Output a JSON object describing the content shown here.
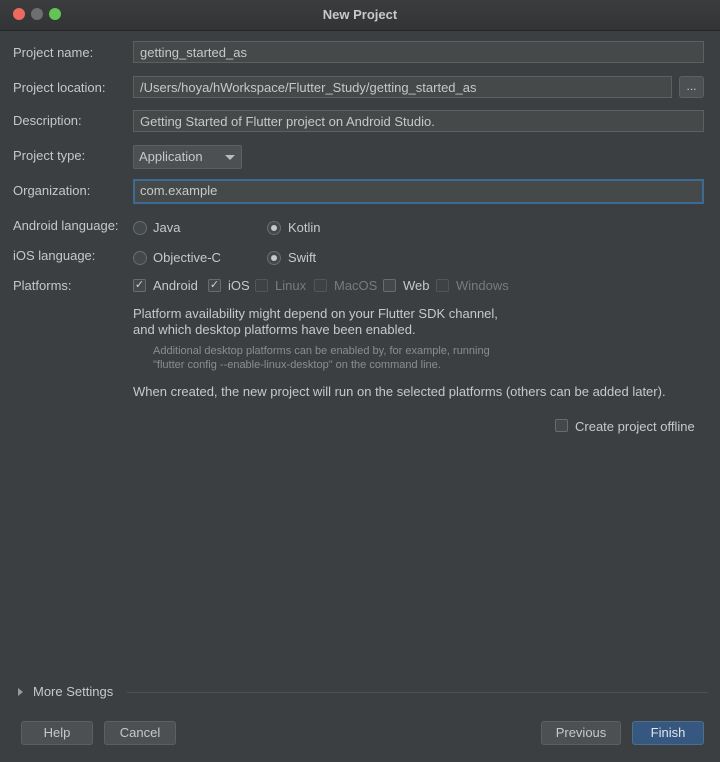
{
  "window": {
    "title": "New Project"
  },
  "labels": {
    "project_name": "Project name:",
    "project_location": "Project location:",
    "description": "Description:",
    "project_type": "Project type:",
    "organization": "Organization:",
    "android_language": "Android language:",
    "ios_language": "iOS language:",
    "platforms": "Platforms:"
  },
  "fields": {
    "project_name": "getting_started_as",
    "project_location": "/Users/hoya/hWorkspace/Flutter_Study/getting_started_as",
    "browse": "...",
    "description": "Getting Started of Flutter project on Android Studio.",
    "project_type": "Application",
    "organization": "com.example"
  },
  "android_language": {
    "options": [
      "Java",
      "Kotlin"
    ],
    "selected": "Kotlin"
  },
  "ios_language": {
    "options": [
      "Objective-C",
      "Swift"
    ],
    "selected": "Swift"
  },
  "platforms": [
    {
      "label": "Android",
      "checked": true,
      "enabled": true
    },
    {
      "label": "iOS",
      "checked": true,
      "enabled": true
    },
    {
      "label": "Linux",
      "checked": false,
      "enabled": false
    },
    {
      "label": "MacOS",
      "checked": false,
      "enabled": false
    },
    {
      "label": "Web",
      "checked": false,
      "enabled": true
    },
    {
      "label": "Windows",
      "checked": false,
      "enabled": false
    }
  ],
  "notes": {
    "availability_1": "Platform availability might depend on your Flutter SDK channel,",
    "availability_2": "and which desktop platforms have been enabled.",
    "hint_1": "Additional desktop platforms can be enabled by, for example, running",
    "hint_2": "\"flutter config --enable-linux-desktop\" on the command line.",
    "when_created": "When created, the new project will run on the selected platforms (others can be added later)."
  },
  "offline": {
    "label": "Create project offline",
    "checked": false
  },
  "more_settings": "More Settings",
  "buttons": {
    "help": "Help",
    "cancel": "Cancel",
    "previous": "Previous",
    "finish": "Finish"
  }
}
